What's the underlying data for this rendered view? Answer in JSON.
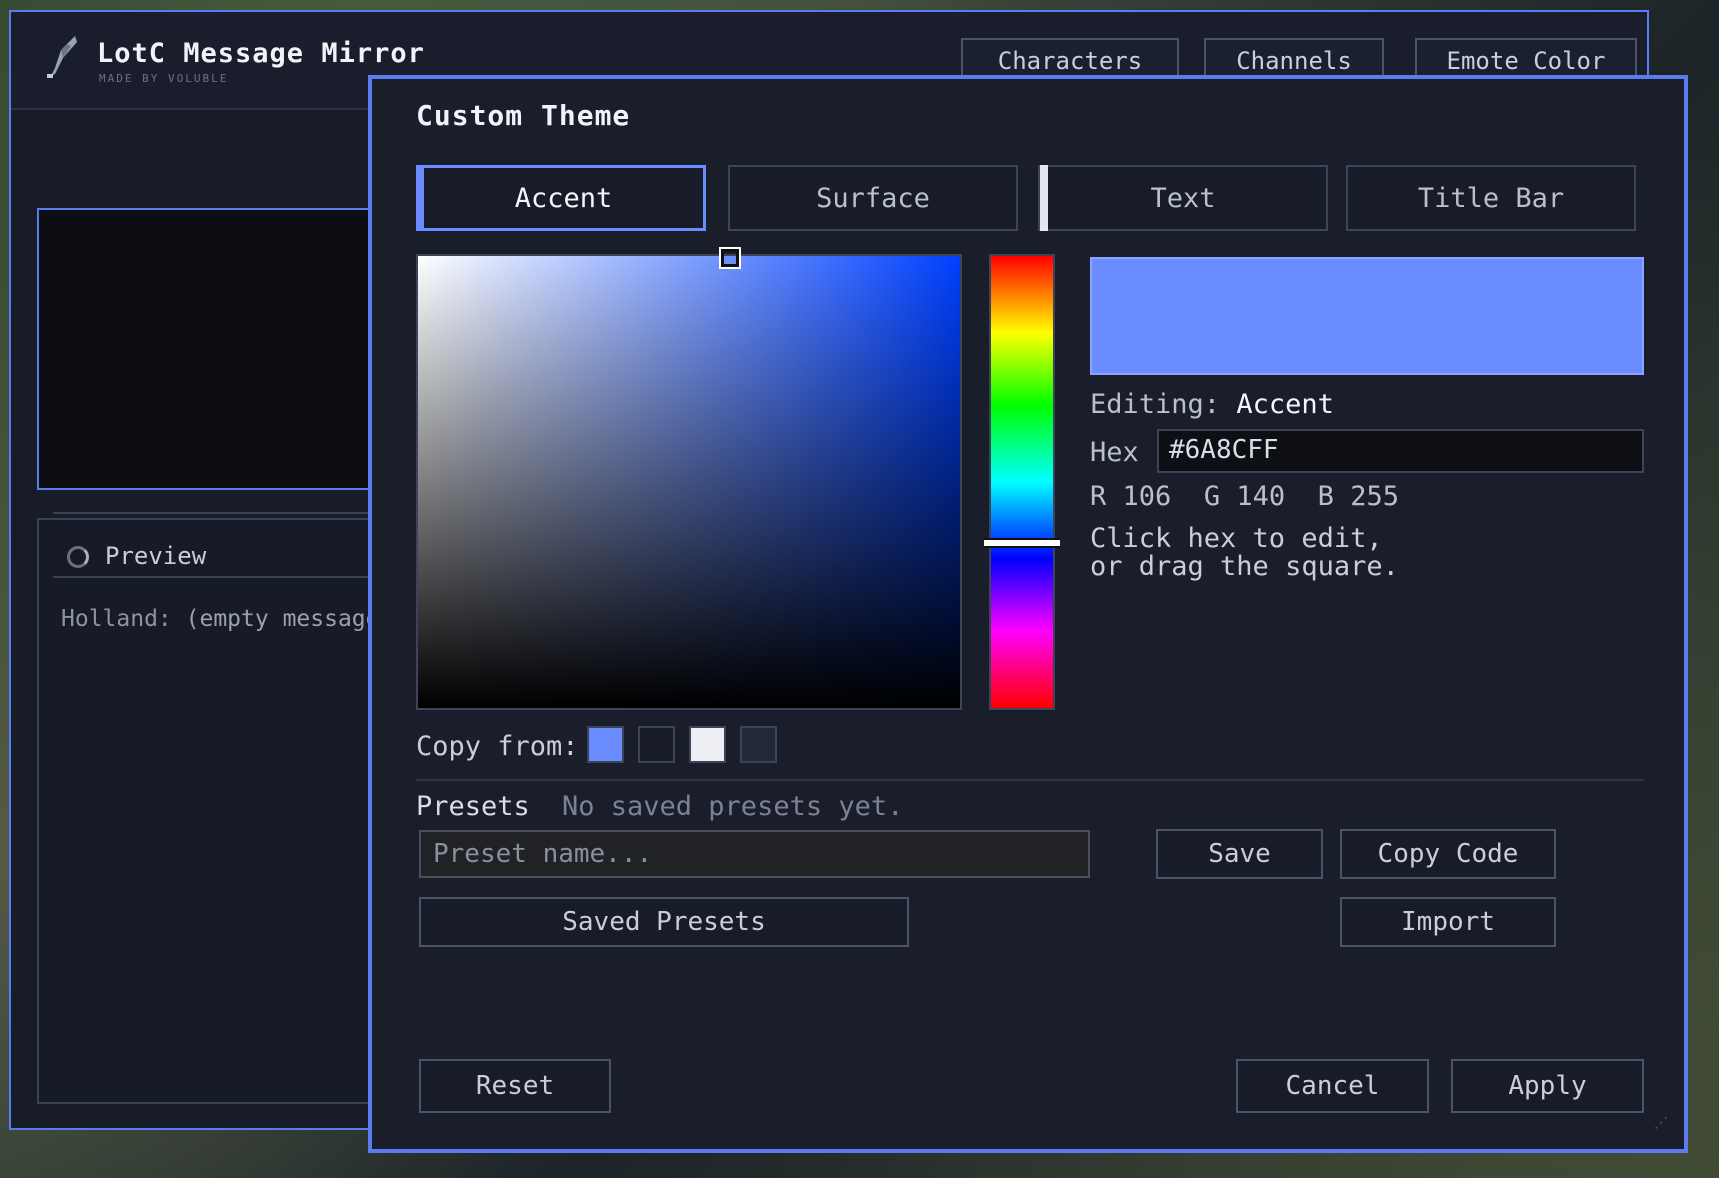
{
  "app": {
    "title": "LotC Message Mirror",
    "subtitle": "MADE BY VOLUBLE",
    "nav": [
      "Characters",
      "Channels",
      "Emote Color"
    ]
  },
  "preview": {
    "label": "Preview",
    "sender": "Holland:",
    "message": "(empty message)"
  },
  "dialog": {
    "title": "Custom Theme",
    "tabs": [
      "Accent",
      "Surface",
      "Text",
      "Title Bar"
    ],
    "active_tab": "Accent",
    "selected_color": "#6A8CFF",
    "hue_position": 0.63,
    "editing_label": "Editing:",
    "editing_value": "Accent",
    "hex_label": "Hex",
    "hex_value": "#6A8CFF",
    "rgb": {
      "r_label": "R",
      "r": "106",
      "g_label": "G",
      "g": "140",
      "b_label": "B",
      "b": "255"
    },
    "hint_line1": "Click hex to edit,",
    "hint_line2": "or drag the square.",
    "copy_from_label": "Copy from:",
    "copy_swatches": [
      "#6A8CFF",
      "#181c28",
      "#eceef3",
      "#232838"
    ],
    "presets_label": "Presets",
    "presets_empty": "No saved presets yet.",
    "preset_placeholder": "Preset name...",
    "save_label": "Save",
    "copy_code_label": "Copy Code",
    "saved_presets_label": "Saved Presets",
    "import_label": "Import",
    "reset_label": "Reset",
    "cancel_label": "Cancel",
    "apply_label": "Apply"
  },
  "colors": {
    "accent": "#5b7cf0",
    "surface": "#1a1e2b",
    "text": "#d9dde6"
  }
}
